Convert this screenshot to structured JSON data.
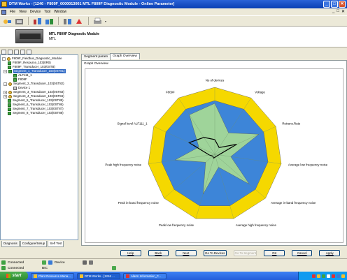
{
  "window": {
    "title": "DTM Works - [1246 - F809F_0000013001 MTL F809F Diagnostic Module - Online Parameter]",
    "minimize": "_",
    "maximize": "□",
    "close": "✕"
  },
  "menubar": {
    "items": [
      "File",
      "View",
      "Device",
      "Tool",
      "Window"
    ],
    "mdi_minimize": "_",
    "mdi_maximize": "□",
    "mdi_close": "✕"
  },
  "header": {
    "title": "MTL F809F Diagnostic Module",
    "subtitle": "MTL"
  },
  "tree": {
    "items": [
      {
        "label": "F809F_Fieldbus_Diagnostic_Module",
        "icon": "bus-icon"
      },
      {
        "label": "F809F_Resource_103(0R0)",
        "icon": "green-block-icon"
      },
      {
        "label": "F809F_Transducer_103(0STB)",
        "icon": "green-block-icon"
      },
      {
        "label": "Segment_1_Transducer_103(0ST81)",
        "icon": "green-block-icon"
      },
      {
        "label": "ALF111_1",
        "icon": "green-block-icon"
      },
      {
        "label": "F809F",
        "icon": "green-block-icon"
      },
      {
        "label": "Segment_2_Transducer_103(0ST82)",
        "icon": "bus-icon"
      },
      {
        "label": "Device 1",
        "icon": "device-icon"
      },
      {
        "label": "Segment_3_Transducer_103(0ST83)",
        "icon": "bus-icon"
      },
      {
        "label": "Segment_4_Transducer_103(0ST84)",
        "icon": "bus-icon"
      },
      {
        "label": "Segment_5_Transducer_103(0ST85)",
        "icon": "green-block-icon"
      },
      {
        "label": "Segment_6_Transducer_103(0ST86)",
        "icon": "green-block-icon"
      },
      {
        "label": "Segment_7_Transducer_103(0ST87)",
        "icon": "green-block-icon"
      },
      {
        "label": "Segment_8_Transducer_103(0ST88)",
        "icon": "green-block-icon"
      }
    ]
  },
  "bottom_tabs": [
    "Diagnosis",
    "Configure/Setup",
    "Self Test"
  ],
  "tabs": [
    "Segment param",
    "Graph Overview"
  ],
  "active_tab": "Graph Overview",
  "section_label": "Graph Overview",
  "chart_data": {
    "type": "radar",
    "axes": [
      "No of devices",
      "Voltage",
      "Retrans.Rate",
      "Average low frequency noise",
      "Average in-band frequency noise",
      "Average high frequency noise",
      "Peak low frequency noise",
      "Peak in-band frequency noise",
      "Peak high frequency noise",
      "Signal level ALF111_1",
      "F809F"
    ],
    "rmax": 100,
    "series": [
      {
        "band": "outer",
        "color": "#f5d800",
        "values": [
          100,
          100,
          100,
          100,
          100,
          100,
          100,
          100,
          100,
          100,
          100
        ]
      },
      {
        "band": "middle",
        "color": "#3d85d8",
        "values": [
          80,
          80,
          80,
          80,
          80,
          80,
          80,
          80,
          80,
          80,
          80
        ]
      },
      {
        "band": "inner",
        "color": "#9fd49a",
        "values": [
          76,
          38,
          72,
          24,
          68,
          20,
          62,
          18,
          60,
          26,
          70
        ]
      },
      {
        "band": "measured",
        "color": "#000000",
        "values": [
          22,
          12,
          36,
          6,
          4,
          4,
          6,
          4,
          8,
          42,
          30
        ]
      }
    ]
  },
  "buttons": [
    {
      "label": "Help",
      "enabled": true
    },
    {
      "label": "Back",
      "enabled": true
    },
    {
      "label": "Next",
      "enabled": true
    },
    {
      "label": "Go To Devices",
      "enabled": true
    },
    {
      "label": "Go To Segment",
      "enabled": false
    },
    {
      "label": "OK",
      "enabled": true
    },
    {
      "label": "Cancel",
      "enabled": true
    },
    {
      "label": "Apply",
      "enabled": true
    }
  ],
  "status": {
    "row1_connection": "Connected",
    "row1_device": "Device",
    "row2_connection": "Connected",
    "row2_type": "BIC"
  },
  "taskbar": {
    "start": "start",
    "tasks": [
      "Plant Resource Mana...",
      "DTM Works - [1246 ...",
      "Alarm Information_F..."
    ]
  },
  "colors": {
    "titlebar": "#0a3fb3",
    "selection": "#316ac5",
    "outer_band": "#f5d800",
    "middle_band": "#3d85d8",
    "inner_band": "#9fd49a"
  }
}
